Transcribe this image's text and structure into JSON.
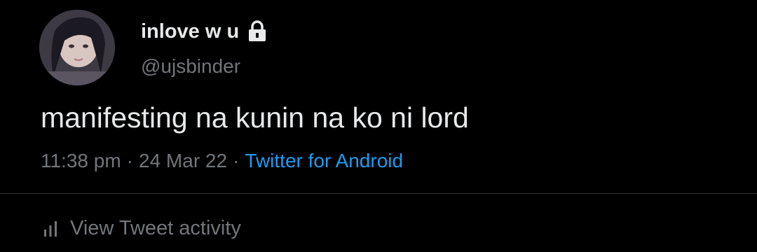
{
  "user": {
    "display_name": "inlove w u",
    "handle": "@ujsbinder",
    "protected_icon": "lock-icon",
    "avatar": "user-avatar"
  },
  "tweet": {
    "text": "manifesting na kunin na ko ni lord",
    "time": "11:38 pm",
    "date": "24 Mar 22",
    "separator": "·",
    "source": "Twitter for Android"
  },
  "activity": {
    "label": "View Tweet activity",
    "icon": "analytics-bars-icon"
  },
  "colors": {
    "background": "#000000",
    "primary_text": "#e7e9ea",
    "secondary_text": "#71767b",
    "link": "#1d9bf0",
    "divider": "#2f3336"
  }
}
